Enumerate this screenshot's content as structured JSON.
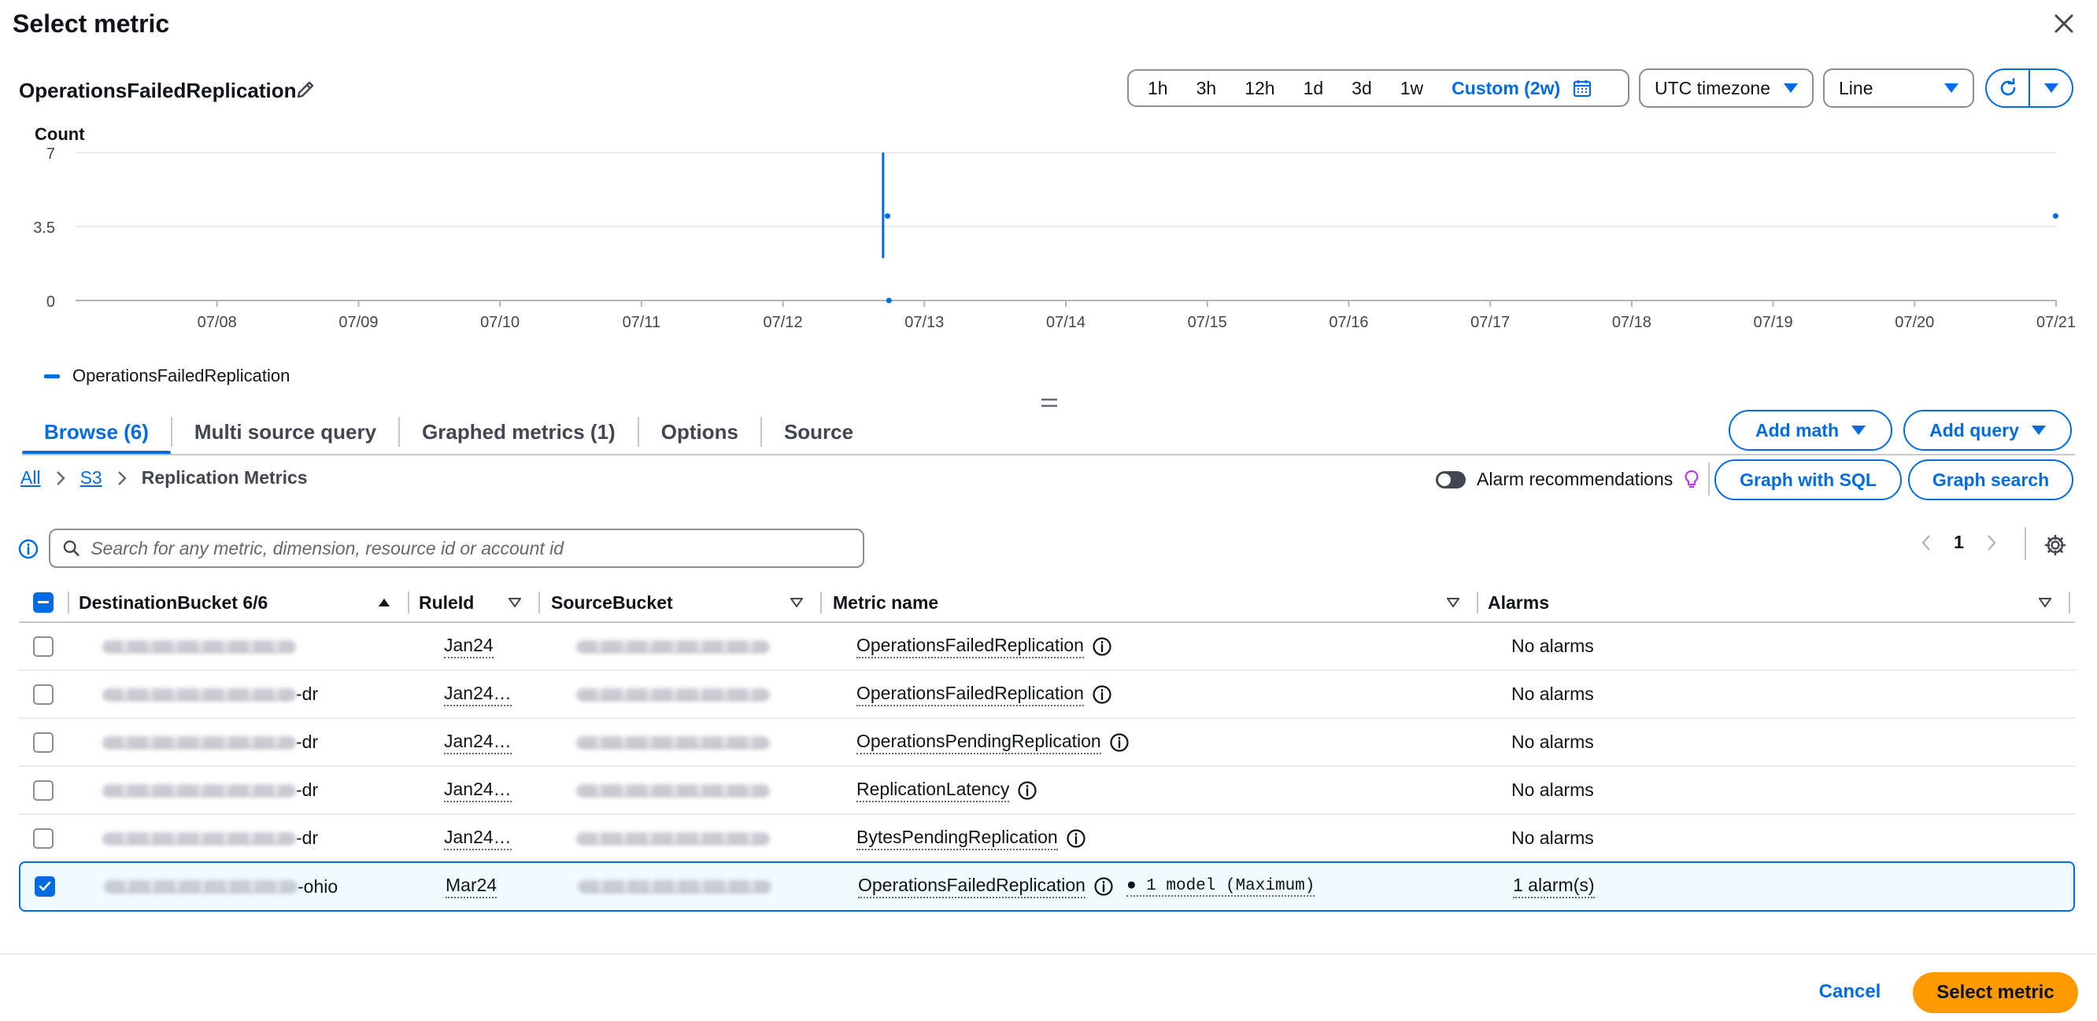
{
  "modal": {
    "title": "Select metric"
  },
  "graph": {
    "metric_title": "OperationsFailedReplication",
    "time_ranges": [
      "1h",
      "3h",
      "12h",
      "1d",
      "3d",
      "1w"
    ],
    "custom_range": "Custom (2w)",
    "timezone": "UTC timezone",
    "view_type": "Line",
    "legend": "OperationsFailedReplication"
  },
  "chart_data": {
    "type": "line",
    "ylabel": "Count",
    "ylim": [
      0,
      7
    ],
    "y_ticks": [
      "7",
      "3.5",
      "0"
    ],
    "x_ticks": [
      "07/08",
      "07/09",
      "07/10",
      "07/11",
      "07/12",
      "07/13",
      "07/14",
      "07/15",
      "07/16",
      "07/17",
      "07/18",
      "07/19",
      "07/20",
      "07/21"
    ],
    "xlim": [
      "07/07 00:00",
      "07/21 00:00"
    ],
    "series": [
      {
        "name": "OperationsFailedReplication",
        "segments": [
          {
            "x": [
              "07/12 17:00",
              "07/12 17:00"
            ],
            "y": [
              7,
              2
            ]
          }
        ],
        "points": [
          {
            "x": "07/12 17:45",
            "y": 4
          },
          {
            "x": "07/12 18:00",
            "y": 0
          },
          {
            "x": "07/20 23:55",
            "y": 4
          }
        ]
      }
    ],
    "grid": true
  },
  "tabs": [
    {
      "label": "Browse (6)",
      "active": true
    },
    {
      "label": "Multi source query",
      "active": false
    },
    {
      "label": "Graphed metrics (1)",
      "active": false
    },
    {
      "label": "Options",
      "active": false
    },
    {
      "label": "Source",
      "active": false
    }
  ],
  "actions": {
    "add_math": "Add math",
    "add_query": "Add query",
    "graph_sql": "Graph with SQL",
    "graph_search": "Graph search"
  },
  "breadcrumb": {
    "all": "All",
    "s3": "S3",
    "current": "Replication Metrics"
  },
  "alarm_recommendations": "Alarm recommendations",
  "search": {
    "placeholder": "Search for any metric, dimension, resource id or account id"
  },
  "pagination": {
    "page": "1"
  },
  "table": {
    "headers": {
      "destination": "DestinationBucket 6/6",
      "rule": "RuleId",
      "source": "SourceBucket",
      "metric": "Metric name",
      "alarms": "Alarms"
    },
    "rows": [
      {
        "dest_suffix": "",
        "rule": "Jan24",
        "metric": "OperationsFailedReplication",
        "model": "",
        "alarms": "No alarms",
        "checked": false
      },
      {
        "dest_suffix": "-dr",
        "rule": "Jan24…",
        "metric": "OperationsFailedReplication",
        "model": "",
        "alarms": "No alarms",
        "checked": false
      },
      {
        "dest_suffix": "-dr",
        "rule": "Jan24…",
        "metric": "OperationsPendingReplication",
        "model": "",
        "alarms": "No alarms",
        "checked": false
      },
      {
        "dest_suffix": "-dr",
        "rule": "Jan24…",
        "metric": "ReplicationLatency",
        "model": "",
        "alarms": "No alarms",
        "checked": false
      },
      {
        "dest_suffix": "-dr",
        "rule": "Jan24…",
        "metric": "BytesPendingReplication",
        "model": "",
        "alarms": "No alarms",
        "checked": false
      },
      {
        "dest_suffix": "-ohio",
        "rule": "Mar24",
        "metric": "OperationsFailedReplication",
        "model": "1 model (Maximum)",
        "alarms": "1 alarm(s)",
        "checked": true
      }
    ]
  },
  "footer": {
    "cancel": "Cancel",
    "select": "Select metric"
  },
  "colors": {
    "primary": "#006ce0",
    "accent": "#ff9900",
    "text": "#0f141a",
    "border": "#c6c6cd"
  }
}
